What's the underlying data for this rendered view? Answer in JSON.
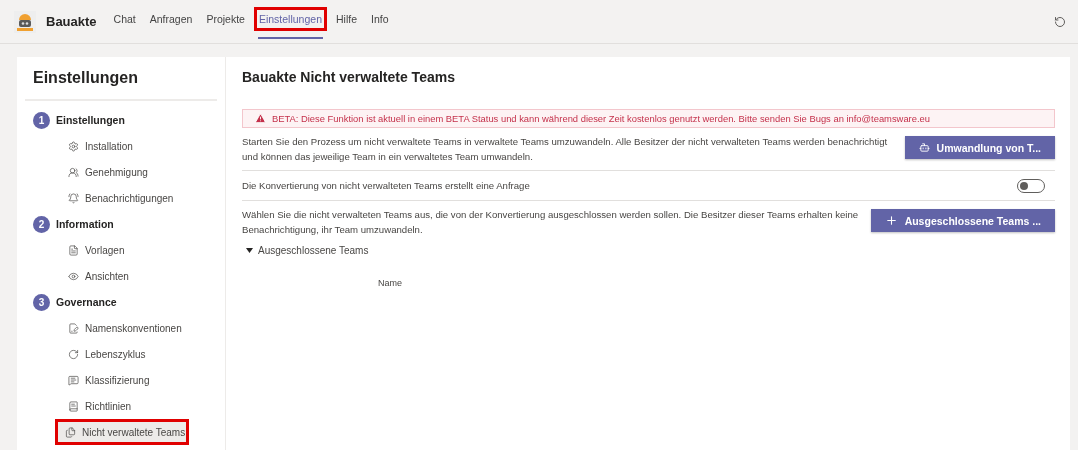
{
  "app": {
    "name": "Bauakte"
  },
  "nav_tabs": [
    {
      "label": "Chat",
      "selected": false,
      "highlighted": false
    },
    {
      "label": "Anfragen",
      "selected": false,
      "highlighted": false
    },
    {
      "label": "Projekte",
      "selected": false,
      "highlighted": false
    },
    {
      "label": "Einstellungen",
      "selected": true,
      "highlighted": true
    },
    {
      "label": "Hilfe",
      "selected": false,
      "highlighted": false
    },
    {
      "label": "Info",
      "selected": false,
      "highlighted": false
    }
  ],
  "sidebar": {
    "title": "Einstellungen",
    "sections": [
      {
        "number": "1",
        "label": "Einstellungen",
        "items": [
          {
            "label": "Installation",
            "selected": false,
            "highlighted": false
          },
          {
            "label": "Genehmigung",
            "selected": false,
            "highlighted": false
          },
          {
            "label": "Benachrichtigungen",
            "selected": false,
            "highlighted": false
          }
        ]
      },
      {
        "number": "2",
        "label": "Information",
        "items": [
          {
            "label": "Vorlagen",
            "selected": false,
            "highlighted": false
          },
          {
            "label": "Ansichten",
            "selected": false,
            "highlighted": false
          }
        ]
      },
      {
        "number": "3",
        "label": "Governance",
        "items": [
          {
            "label": "Namenskonventionen",
            "selected": false,
            "highlighted": false
          },
          {
            "label": "Lebenszyklus",
            "selected": false,
            "highlighted": false
          },
          {
            "label": "Klassifizierung",
            "selected": false,
            "highlighted": false
          },
          {
            "label": "Richtlinien",
            "selected": false,
            "highlighted": false
          },
          {
            "label": "Nicht verwaltete Teams",
            "selected": true,
            "highlighted": true
          }
        ]
      }
    ]
  },
  "content": {
    "title": "Bauakte Nicht verwaltete Teams",
    "warning": "BETA: Diese Funktion ist aktuell in einem BETA Status und kann während dieser Zeit kostenlos genutzt werden. Bitte senden Sie Bugs an info@teamsware.eu",
    "conversion": {
      "text": "Starten Sie den Prozess um nicht verwaltete Teams in verwaltete Teams umzuwandeln. Alle Besitzer der nicht verwalteten Teams werden benachrichtigt und können das jeweilige Team in ein verwaltetes Team umwandeln.",
      "button": "Umwandlung von T..."
    },
    "request_setting": {
      "label": "Die Konvertierung von nicht verwalteten Teams erstellt eine Anfrage",
      "on": false
    },
    "exclusion": {
      "text": "Wählen Sie die nicht verwalteten Teams aus, die von der Konvertierung ausgeschlossen werden sollen. Die Besitzer dieser Teams erhalten keine Benachrichtigung, ihr Team umzuwandeln.",
      "button": "Ausgeschlossene Teams ..."
    },
    "excluded_teams": {
      "label": "Ausgeschlossene Teams",
      "expanded": true,
      "columns": [
        "Name"
      ]
    }
  }
}
